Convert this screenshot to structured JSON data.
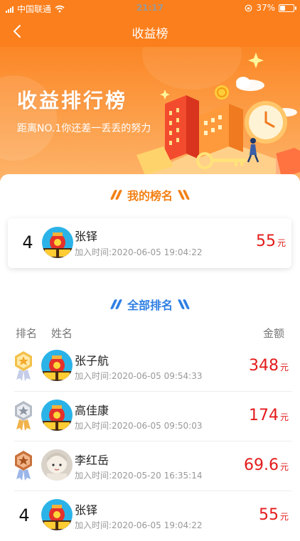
{
  "status_bar": {
    "carrier": "中国联通",
    "time": "21:17",
    "battery": "37%",
    "battery_level": 0.37
  },
  "nav": {
    "title": "收益榜"
  },
  "banner": {
    "headline": "收益排行榜",
    "subtitle": "距离NO.1你还差一丢丢的努力"
  },
  "my_rank": {
    "title": "我的榜名",
    "rank": "4",
    "name": "张铎",
    "joined": "加入时间:2020-06-05 19:04:22",
    "amount": "55",
    "unit": "元"
  },
  "all_ranks": {
    "title": "全部排名",
    "headers": {
      "rank": "排名",
      "name": "姓名",
      "amount": "金额"
    },
    "rows": [
      {
        "medal": "gold-medal-icon",
        "name": "张子航",
        "joined": "加入时间:2020-06-05 09:54:33",
        "amount": "348",
        "unit": "元"
      },
      {
        "medal": "silver-medal-icon",
        "name": "高佳康",
        "joined": "加入时间:2020-06-05 09:50:03",
        "amount": "174",
        "unit": "元"
      },
      {
        "medal": "bronze-medal-icon",
        "name": "李红岳",
        "joined": "加入时间:2020-05-20 16:35:14",
        "amount": "69.6",
        "unit": "元"
      },
      {
        "rank": "4",
        "name": "张铎",
        "joined": "加入时间:2020-06-05 19:04:22",
        "amount": "55",
        "unit": "元"
      }
    ]
  },
  "colors": {
    "brand_orange": "#fb7f1c",
    "amount_red": "#e31b1b",
    "rank_blue": "#2f7fe3"
  }
}
